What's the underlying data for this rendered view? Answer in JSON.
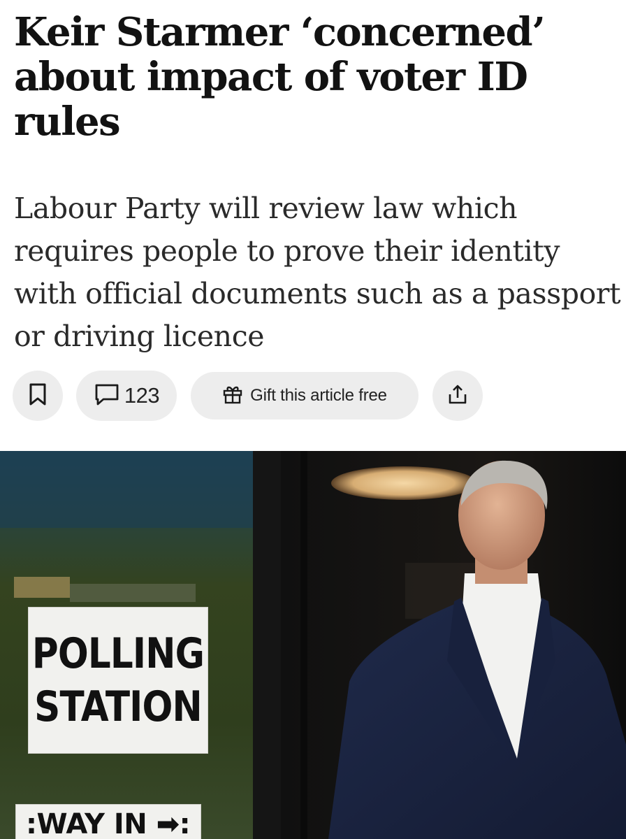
{
  "article": {
    "headline": "Keir Starmer ‘concerned’ about impact of voter ID rules",
    "standfirst": "Labour Party will review law which requires people to prove their identity with official documents such as a passport or driving licence"
  },
  "actions": {
    "comment_count": "123",
    "gift_label": "Gift this article free"
  },
  "photo": {
    "sign_line1": "POLLING",
    "sign_line2": "STATION",
    "way_in": ":WAY IN ➡:"
  },
  "icons": {
    "save": "bookmark-icon",
    "comments": "comment-bubble-icon",
    "gift": "gift-icon",
    "share": "share-icon"
  }
}
